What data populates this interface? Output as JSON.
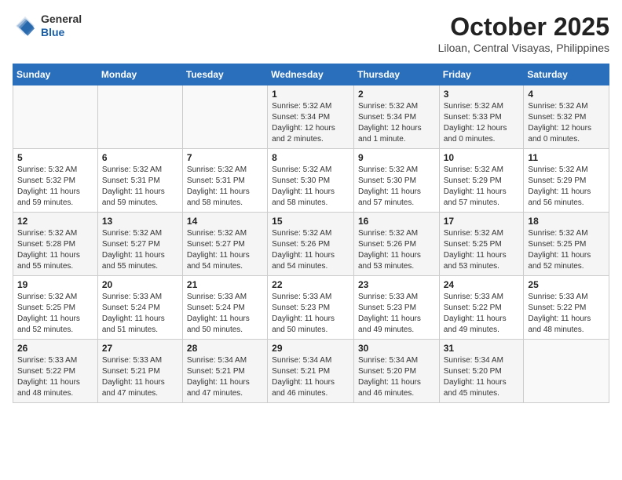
{
  "header": {
    "logo": {
      "general": "General",
      "blue": "Blue"
    },
    "title": "October 2025",
    "location": "Liloan, Central Visayas, Philippines"
  },
  "days_of_week": [
    "Sunday",
    "Monday",
    "Tuesday",
    "Wednesday",
    "Thursday",
    "Friday",
    "Saturday"
  ],
  "weeks": [
    [
      {
        "day": "",
        "info": ""
      },
      {
        "day": "",
        "info": ""
      },
      {
        "day": "",
        "info": ""
      },
      {
        "day": "1",
        "info": "Sunrise: 5:32 AM\nSunset: 5:34 PM\nDaylight: 12 hours and 2 minutes."
      },
      {
        "day": "2",
        "info": "Sunrise: 5:32 AM\nSunset: 5:34 PM\nDaylight: 12 hours and 1 minute."
      },
      {
        "day": "3",
        "info": "Sunrise: 5:32 AM\nSunset: 5:33 PM\nDaylight: 12 hours and 0 minutes."
      },
      {
        "day": "4",
        "info": "Sunrise: 5:32 AM\nSunset: 5:32 PM\nDaylight: 12 hours and 0 minutes."
      }
    ],
    [
      {
        "day": "5",
        "info": "Sunrise: 5:32 AM\nSunset: 5:32 PM\nDaylight: 11 hours and 59 minutes."
      },
      {
        "day": "6",
        "info": "Sunrise: 5:32 AM\nSunset: 5:31 PM\nDaylight: 11 hours and 59 minutes."
      },
      {
        "day": "7",
        "info": "Sunrise: 5:32 AM\nSunset: 5:31 PM\nDaylight: 11 hours and 58 minutes."
      },
      {
        "day": "8",
        "info": "Sunrise: 5:32 AM\nSunset: 5:30 PM\nDaylight: 11 hours and 58 minutes."
      },
      {
        "day": "9",
        "info": "Sunrise: 5:32 AM\nSunset: 5:30 PM\nDaylight: 11 hours and 57 minutes."
      },
      {
        "day": "10",
        "info": "Sunrise: 5:32 AM\nSunset: 5:29 PM\nDaylight: 11 hours and 57 minutes."
      },
      {
        "day": "11",
        "info": "Sunrise: 5:32 AM\nSunset: 5:29 PM\nDaylight: 11 hours and 56 minutes."
      }
    ],
    [
      {
        "day": "12",
        "info": "Sunrise: 5:32 AM\nSunset: 5:28 PM\nDaylight: 11 hours and 55 minutes."
      },
      {
        "day": "13",
        "info": "Sunrise: 5:32 AM\nSunset: 5:27 PM\nDaylight: 11 hours and 55 minutes."
      },
      {
        "day": "14",
        "info": "Sunrise: 5:32 AM\nSunset: 5:27 PM\nDaylight: 11 hours and 54 minutes."
      },
      {
        "day": "15",
        "info": "Sunrise: 5:32 AM\nSunset: 5:26 PM\nDaylight: 11 hours and 54 minutes."
      },
      {
        "day": "16",
        "info": "Sunrise: 5:32 AM\nSunset: 5:26 PM\nDaylight: 11 hours and 53 minutes."
      },
      {
        "day": "17",
        "info": "Sunrise: 5:32 AM\nSunset: 5:25 PM\nDaylight: 11 hours and 53 minutes."
      },
      {
        "day": "18",
        "info": "Sunrise: 5:32 AM\nSunset: 5:25 PM\nDaylight: 11 hours and 52 minutes."
      }
    ],
    [
      {
        "day": "19",
        "info": "Sunrise: 5:32 AM\nSunset: 5:25 PM\nDaylight: 11 hours and 52 minutes."
      },
      {
        "day": "20",
        "info": "Sunrise: 5:33 AM\nSunset: 5:24 PM\nDaylight: 11 hours and 51 minutes."
      },
      {
        "day": "21",
        "info": "Sunrise: 5:33 AM\nSunset: 5:24 PM\nDaylight: 11 hours and 50 minutes."
      },
      {
        "day": "22",
        "info": "Sunrise: 5:33 AM\nSunset: 5:23 PM\nDaylight: 11 hours and 50 minutes."
      },
      {
        "day": "23",
        "info": "Sunrise: 5:33 AM\nSunset: 5:23 PM\nDaylight: 11 hours and 49 minutes."
      },
      {
        "day": "24",
        "info": "Sunrise: 5:33 AM\nSunset: 5:22 PM\nDaylight: 11 hours and 49 minutes."
      },
      {
        "day": "25",
        "info": "Sunrise: 5:33 AM\nSunset: 5:22 PM\nDaylight: 11 hours and 48 minutes."
      }
    ],
    [
      {
        "day": "26",
        "info": "Sunrise: 5:33 AM\nSunset: 5:22 PM\nDaylight: 11 hours and 48 minutes."
      },
      {
        "day": "27",
        "info": "Sunrise: 5:33 AM\nSunset: 5:21 PM\nDaylight: 11 hours and 47 minutes."
      },
      {
        "day": "28",
        "info": "Sunrise: 5:34 AM\nSunset: 5:21 PM\nDaylight: 11 hours and 47 minutes."
      },
      {
        "day": "29",
        "info": "Sunrise: 5:34 AM\nSunset: 5:21 PM\nDaylight: 11 hours and 46 minutes."
      },
      {
        "day": "30",
        "info": "Sunrise: 5:34 AM\nSunset: 5:20 PM\nDaylight: 11 hours and 46 minutes."
      },
      {
        "day": "31",
        "info": "Sunrise: 5:34 AM\nSunset: 5:20 PM\nDaylight: 11 hours and 45 minutes."
      },
      {
        "day": "",
        "info": ""
      }
    ]
  ]
}
